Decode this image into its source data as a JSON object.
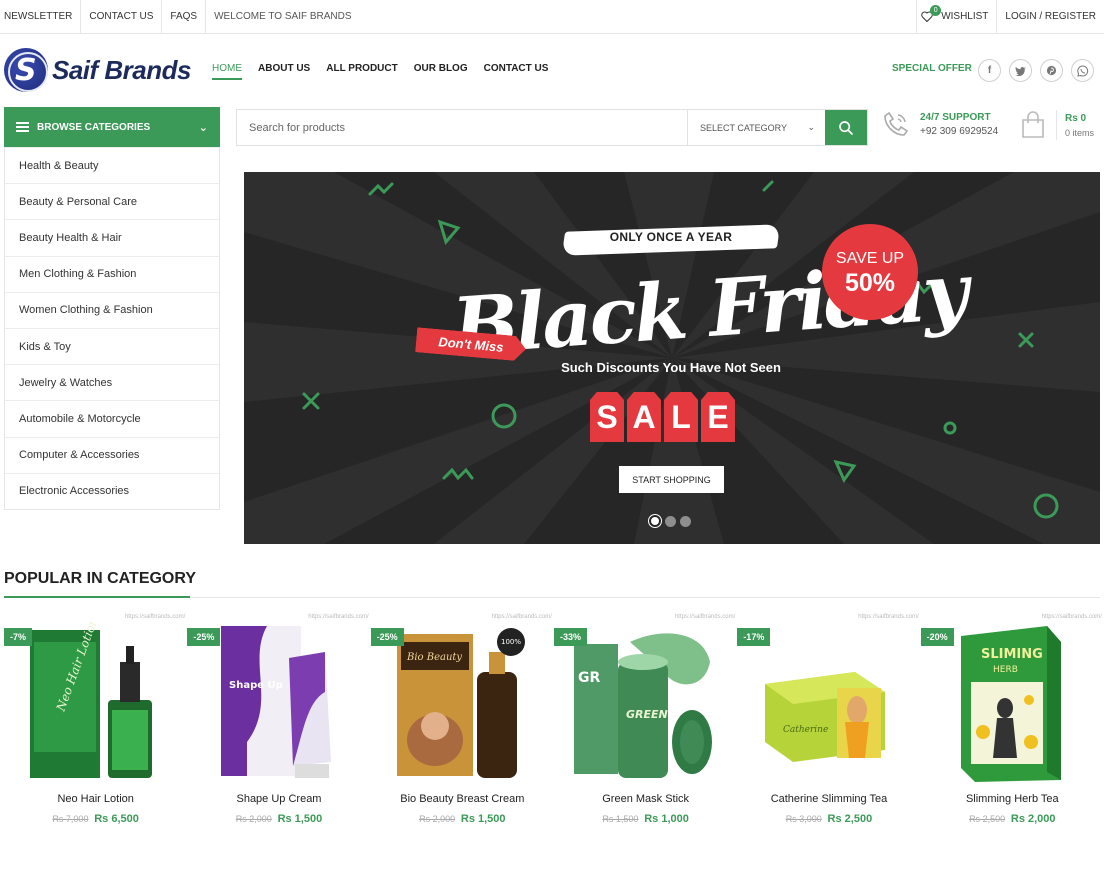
{
  "topbar": {
    "newsletter": "NEWSLETTER",
    "contact": "CONTACT US",
    "faqs": "FAQS",
    "welcome": "WELCOME TO SAIF BRANDS",
    "wishlist": "WISHLIST",
    "wishlist_count": "0",
    "login": "LOGIN / REGISTER"
  },
  "header": {
    "logo_text": "Saif Brands",
    "nav": [
      "HOME",
      "ABOUT US",
      "ALL PRODUCT",
      "OUR BLOG",
      "CONTACT US"
    ],
    "special_offer": "SPECIAL OFFER",
    "socials": [
      "facebook-icon",
      "twitter-icon",
      "pinterest-icon",
      "whatsapp-icon"
    ]
  },
  "categories": {
    "title": "BROWSE CATEGORIES",
    "items": [
      "Health & Beauty",
      "Beauty & Personal Care",
      "Beauty Health & Hair",
      "Men Clothing & Fashion",
      "Women Clothing & Fashion",
      "Kids & Toy",
      "Jewelry & Watches",
      "Automobile & Motorcycle",
      "Computer & Accessories",
      "Electronic Accessories"
    ]
  },
  "search": {
    "placeholder": "Search for products",
    "category_select": "SELECT CATEGORY"
  },
  "support": {
    "title": "24/7 SUPPORT",
    "phone": "+92 309 6929524"
  },
  "cart": {
    "total": "Rs 0",
    "items": "0 items"
  },
  "banner": {
    "once": "ONLY ONCE A YEAR",
    "headline": "Black Friday",
    "save_line1": "SAVE UP",
    "save_line2": "50%",
    "dont_miss": "Don't Miss",
    "discount_text": "Such Discounts You Have Not Seen",
    "sale_letters": [
      "S",
      "A",
      "L",
      "E"
    ],
    "cta": "START SHOPPING",
    "slides": 3,
    "active_slide": 1
  },
  "popular": {
    "title": "POPULAR IN CATEGORY",
    "watermark": "https://saifbrands.com/",
    "products": [
      {
        "name": "Neo Hair Lotion",
        "discount": "-7%",
        "old_price": "Rs 7,000",
        "new_price": "Rs 6,500"
      },
      {
        "name": "Shape Up Cream",
        "discount": "-25%",
        "old_price": "Rs 2,000",
        "new_price": "Rs 1,500"
      },
      {
        "name": "Bio Beauty Breast Cream",
        "discount": "-25%",
        "old_price": "Rs 2,000",
        "new_price": "Rs 1,500"
      },
      {
        "name": "Green Mask Stick",
        "discount": "-33%",
        "old_price": "Rs 1,500",
        "new_price": "Rs 1,000"
      },
      {
        "name": "Catherine Slimming Tea",
        "discount": "-17%",
        "old_price": "Rs 3,000",
        "new_price": "Rs 2,500"
      },
      {
        "name": "Slimming Herb Tea",
        "discount": "-20%",
        "old_price": "Rs 2,500",
        "new_price": "Rs 2,000"
      }
    ]
  },
  "colors": {
    "brand_green": "#3c9a58",
    "banner_bg": "#262626",
    "accent_red": "#e43a3f",
    "logo_blue": "#1d2a5c"
  }
}
